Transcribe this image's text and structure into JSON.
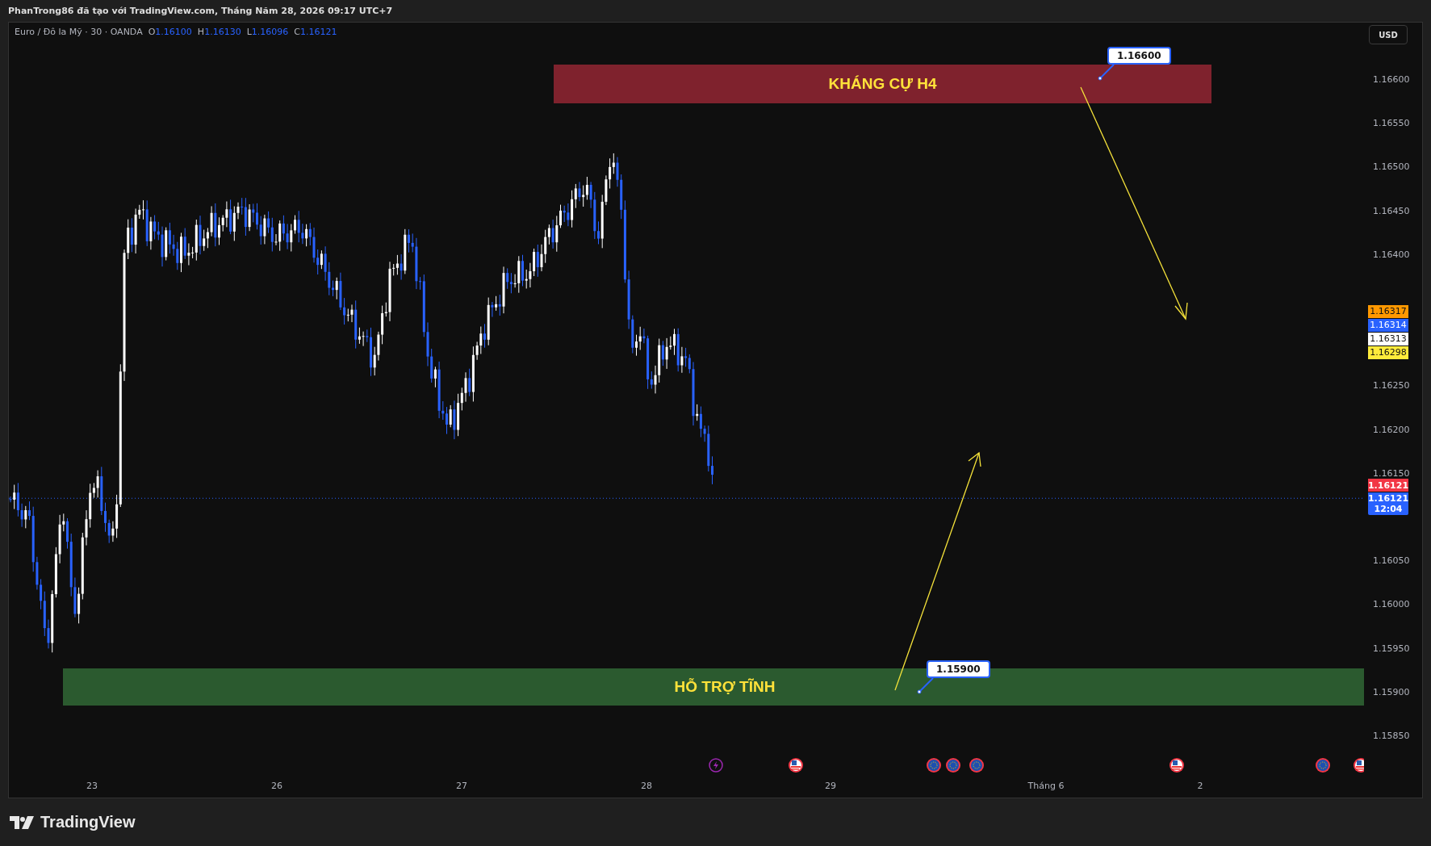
{
  "header": {
    "text": "PhanTrong86 đã tạo với TradingView.com, Tháng Năm 28, 2026 09:17 UTC+7"
  },
  "legend": {
    "symbol": "Euro / Đô la Mỹ · 30 · OANDA",
    "ohlc": [
      {
        "label": "O",
        "value": "1.16100"
      },
      {
        "label": "H",
        "value": "1.16130"
      },
      {
        "label": "L",
        "value": "1.16096"
      },
      {
        "label": "C",
        "value": "1.16121"
      }
    ]
  },
  "currency_button": "USD",
  "zones": [
    {
      "kind": "resistance",
      "label": "KHÁNG CỰ H4"
    },
    {
      "kind": "support",
      "label": "HỖ TRỢ TĨNH"
    }
  ],
  "callouts": [
    {
      "kind": "top",
      "text": "1.16600"
    },
    {
      "kind": "bottom",
      "text": "1.15900"
    }
  ],
  "price_axis": {
    "labels": [
      "1.16600",
      "1.16550",
      "1.16500",
      "1.16450",
      "1.16400",
      "1.16250",
      "1.16200",
      "1.16150",
      "1.16050",
      "1.16000",
      "1.15950",
      "1.15900",
      "1.15850"
    ]
  },
  "price_tags": [
    {
      "value": "1.16317",
      "color": "#ff9800"
    },
    {
      "value": "1.16314",
      "color": "#2962ff"
    },
    {
      "value": "1.16313",
      "color": "#ffffff"
    },
    {
      "value": "1.16298",
      "color": "#ffeb3b"
    }
  ],
  "current_price": {
    "last": "1.16121",
    "value": "1.16121",
    "countdown": "12:04"
  },
  "time_axis": {
    "labels": [
      "23",
      "26",
      "27",
      "28",
      "29",
      "Tháng 6",
      "2"
    ]
  },
  "footer": {
    "brand": "TradingView"
  }
}
